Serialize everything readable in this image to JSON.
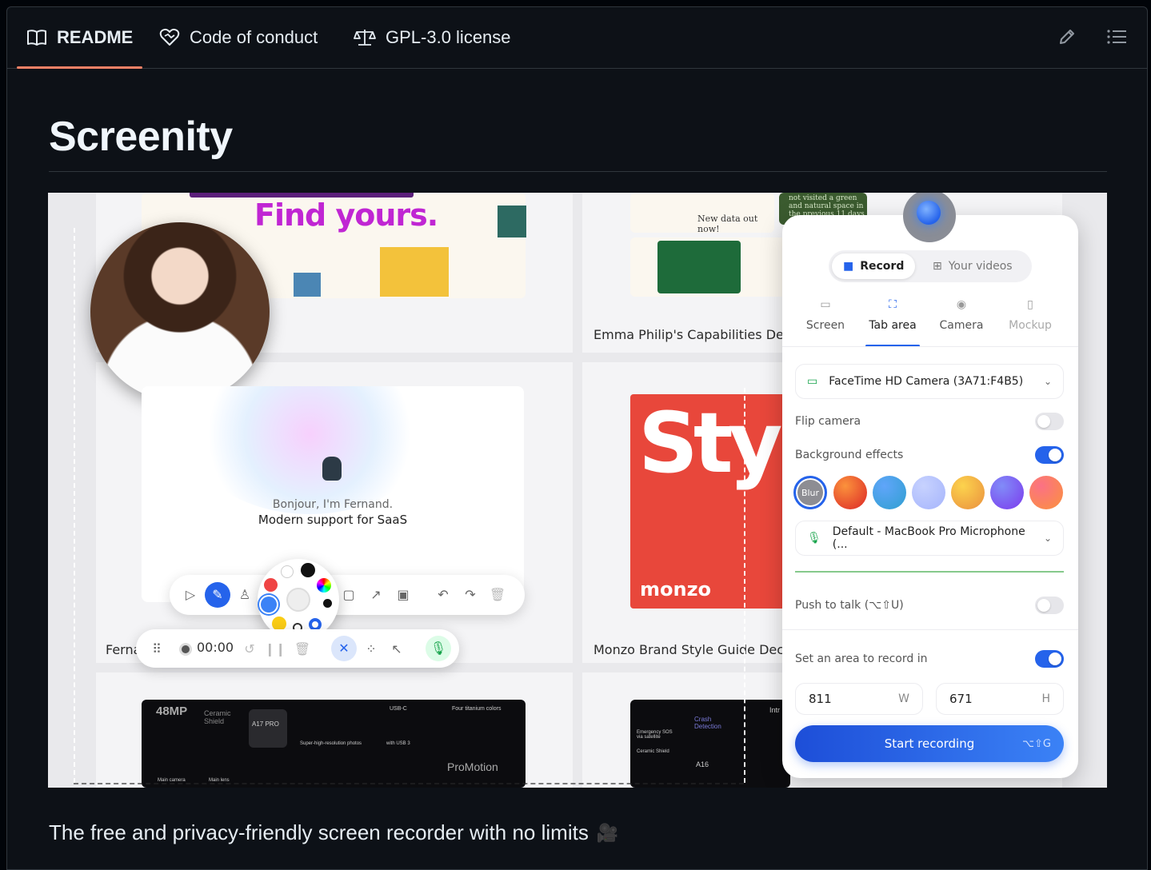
{
  "tabs": [
    {
      "label": "README",
      "icon": "book-icon",
      "active": true
    },
    {
      "label": "Code of conduct",
      "icon": "heart-handshake-icon",
      "active": false
    },
    {
      "label": "GPL-3.0 license",
      "icon": "law-scale-icon",
      "active": false
    }
  ],
  "toolbar": {
    "edit_icon": "pencil-icon",
    "outline_icon": "list-icon"
  },
  "readme": {
    "title": "Screenity",
    "tagline": "The free and privacy-friendly screen recorder with no limits",
    "tagline_emoji": "🎥"
  },
  "hero": {
    "headline_fragment": "Find yours.",
    "small_ad_text": "New data out now!",
    "green_text": "not visited a green and natural space in the previous 11 days",
    "card_labels": {
      "emma": "Emma Philip's Capabilities Deck",
      "fernand_short": "Ferna",
      "monzo": "Monzo Brand Style Guide Deck"
    },
    "fernand": {
      "line1": "Bonjour, I'm Fernand.",
      "line2": "Modern support for SaaS"
    },
    "monzo": {
      "big": "Sty",
      "brand": "monzo"
    },
    "timer": "00:00",
    "phones": {
      "left": [
        "48MP",
        "Ceramic Shield",
        "A17 PRO",
        "USB-C",
        "Four titanium colors",
        "ProMotion",
        "Super-high-resolution photos",
        "with USB 3",
        "Main camera",
        "Main lens"
      ],
      "right": [
        "Crash Detection",
        "Emergency SOS via satellite",
        "Ceramic Shield",
        "A16",
        "Intr"
      ]
    },
    "recorder": {
      "segments": [
        {
          "label": "Record",
          "active": true
        },
        {
          "label": "Your videos",
          "active": false
        }
      ],
      "modes": [
        {
          "label": "Screen",
          "icon": "monitor-icon",
          "state": "normal"
        },
        {
          "label": "Tab area",
          "icon": "crop-icon",
          "state": "active"
        },
        {
          "label": "Camera",
          "icon": "user-circle-icon",
          "state": "normal"
        },
        {
          "label": "Mockup",
          "icon": "phone-icon",
          "state": "dim"
        }
      ],
      "camera_select": "FaceTime HD Camera (3A71:F4B5)",
      "flip_camera": {
        "label": "Flip camera",
        "on": false
      },
      "background_effects": {
        "label": "Background effects",
        "on": true
      },
      "swatches": [
        "Blur",
        "#f97316",
        "#2f9fd0",
        "#b4bcf8",
        "#f0a64c",
        "#7c3aed",
        "#f472b6"
      ],
      "mic_select": "Default - MacBook Pro Microphone (...",
      "push_to_talk": {
        "label": "Push to talk (⌥⇧U)",
        "on": false
      },
      "area": {
        "label": "Set an area to record in",
        "on": true
      },
      "width": {
        "value": "811",
        "unit": "W"
      },
      "height": {
        "value": "671",
        "unit": "H"
      },
      "start": {
        "label": "Start recording",
        "shortcut": "⌥⇧G"
      }
    }
  }
}
